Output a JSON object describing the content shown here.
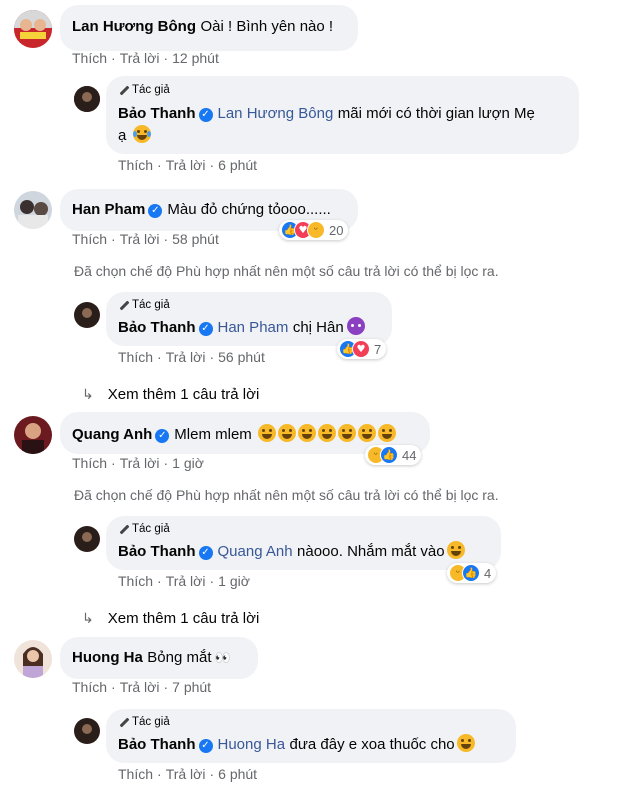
{
  "actions": {
    "like": "Thích",
    "reply": "Trả lời"
  },
  "author_badge": "Tác giả",
  "filter_notice": "Đã chọn chế độ Phù hợp nhất nên một số câu trả lời có thể bị lọc ra.",
  "see_more": "Xem thêm 1 câu trả lời",
  "comments": [
    {
      "name": "Lan Hương Bông",
      "text": "Oài ! Bình yên nào !",
      "time": "12 phút",
      "reply": {
        "name": "Bảo Thanh",
        "tag": "Lan Hương Bông",
        "text1": "mãi mới có thời gian lượn Mẹ",
        "text2": "ạ",
        "time": "6 phút"
      }
    },
    {
      "name": "Han Pham",
      "text": "Màu đỏ chứng tỏooo......",
      "time": "58 phút",
      "reaction_count": "20",
      "reply": {
        "name": "Bảo Thanh",
        "tag": "Han Pham",
        "text": "chị Hân",
        "time": "56 phút",
        "reaction_count": "7"
      }
    },
    {
      "name": "Quang Anh",
      "text": "Mlem mlem",
      "time": "1 giờ",
      "reaction_count": "44",
      "reply": {
        "name": "Bảo Thanh",
        "tag": "Quang Anh",
        "text": "nàooo. Nhắm mắt vào",
        "time": "1 giờ",
        "reaction_count": "4"
      }
    },
    {
      "name": "Huong Ha",
      "text": "Bỏng mắt",
      "time": "7 phút",
      "reply": {
        "name": "Bảo Thanh",
        "tag": "Huong Ha",
        "text": "đưa đây e xoa thuốc cho",
        "time": "6 phút"
      }
    }
  ],
  "colors": {
    "bubble": "#f0f2f5",
    "link": "#385898",
    "muted": "#65676b",
    "verified": "#1877f2"
  }
}
